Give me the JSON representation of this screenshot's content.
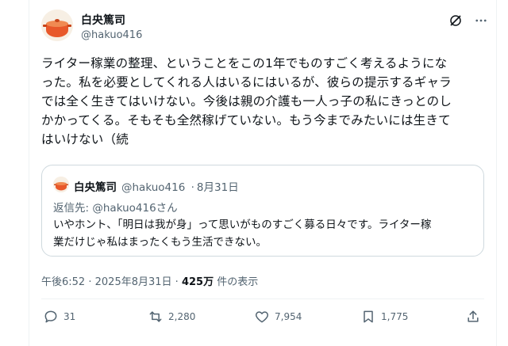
{
  "author": {
    "display_name": "白央篤司",
    "handle": "@hakuo416"
  },
  "icons": {
    "top": [
      "grok-icon",
      "more-icon"
    ],
    "actions": [
      "reply-icon",
      "repost-icon",
      "like-icon",
      "bookmark-icon",
      "share-icon"
    ]
  },
  "post": {
    "lines": [
      "ライター稼業の整理、ということをこの1年でものすごく考えるようにな",
      "った。私を必要としてくれる人はいるにはいるが、彼らの提示するギャラ",
      "では全く生きてはいけない。今後は親の介護も一人っ子の私にきっとのし",
      "かかってくる。そもそも全然稼げていない。もう今までみたいには生きて",
      "はいけない（続"
    ]
  },
  "quote": {
    "display_name": "白央篤司",
    "handle": "@hakuo416",
    "separator": "·",
    "date": "8月31日",
    "reply_to_label": "返信先:",
    "reply_to_handle": "@hakuo416さん",
    "lines": [
      "いやホント、「明日は我が身」って思いがものすごく募る日々です。ライター稼",
      "業だけじゃ私はまったくもう生活できない。"
    ]
  },
  "meta": {
    "time": "午後6:52",
    "separator": "·",
    "date": "2025年8月31日",
    "views_count": "425万",
    "views_label": "件の表示"
  },
  "stats": {
    "replies": "31",
    "reposts": "2,280",
    "likes": "7,954",
    "bookmarks": "1,775"
  },
  "colors": {
    "text": "#0f1419",
    "secondary": "#536471",
    "border": "#cfd9de",
    "avatar_orange": "#e8582a"
  }
}
